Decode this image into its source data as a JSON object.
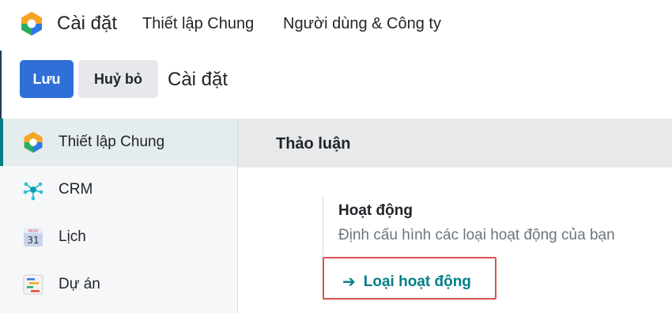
{
  "header": {
    "app_title": "Cài đặt",
    "menu": [
      "Thiết lập Chung",
      "Người dùng & Công ty"
    ]
  },
  "control_panel": {
    "save_label": "Lưu",
    "cancel_label": "Huỷ bỏ",
    "breadcrumb": "Cài đặt"
  },
  "sidebar": {
    "items": [
      {
        "label": "Thiết lập Chung",
        "icon": "settings-app-icon",
        "active": true
      },
      {
        "label": "CRM",
        "icon": "crm-icon",
        "active": false
      },
      {
        "label": "Lịch",
        "icon": "calendar-icon",
        "calendar_month": "MON",
        "calendar_day": "31",
        "active": false
      },
      {
        "label": "Dự án",
        "icon": "project-icon",
        "active": false
      }
    ]
  },
  "main": {
    "section_title": "Thảo luận",
    "setting": {
      "title": "Hoạt động",
      "description": "Định cấu hình các loại hoạt động của bạn",
      "link_arrow": "➔",
      "link_label": "Loại hoạt động"
    }
  },
  "colors": {
    "primary": "#2f6fd8",
    "accent_teal": "#017e84",
    "highlight": "#d9534f"
  }
}
